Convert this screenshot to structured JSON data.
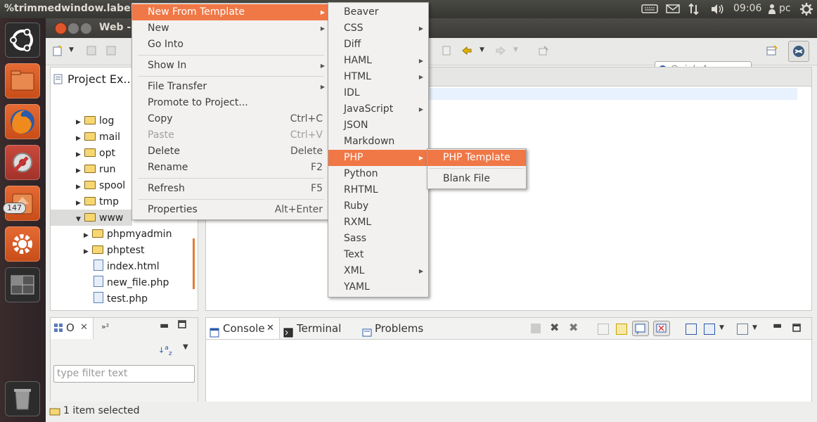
{
  "top_panel": {
    "window_title": "%trimmedwindow.label.e",
    "time": "09:06",
    "user": "pc"
  },
  "launcher": {
    "badge_count": "147",
    "items": [
      "ubuntu-dash",
      "files",
      "firefox",
      "system-settings-tools",
      "software-updater",
      "settings",
      "workspace-switcher",
      "trash"
    ]
  },
  "window": {
    "title": "Web - ",
    "quick_access_placeholder": "Quick Access"
  },
  "project_explorer": {
    "title": "Project Ex...",
    "tree": [
      {
        "label": "log",
        "type": "folder",
        "expanded": false
      },
      {
        "label": "mail",
        "type": "folder",
        "expanded": false
      },
      {
        "label": "opt",
        "type": "folder",
        "expanded": false
      },
      {
        "label": "run",
        "type": "folder",
        "expanded": false
      },
      {
        "label": "spool",
        "type": "folder",
        "expanded": false
      },
      {
        "label": "tmp",
        "type": "folder",
        "expanded": false
      },
      {
        "label": "www",
        "type": "folder",
        "expanded": true
      },
      {
        "label": "phpmyadmin",
        "type": "folder",
        "expanded": false
      },
      {
        "label": "phptest",
        "type": "folder",
        "expanded": false
      },
      {
        "label": "index.html",
        "type": "file"
      },
      {
        "label": "new_file.php",
        "type": "file"
      },
      {
        "label": "test.php",
        "type": "file"
      }
    ]
  },
  "outline_panel": {
    "tab1": "O",
    "tab2": "²",
    "filter_placeholder": "type filter text"
  },
  "bottom_panel": {
    "tabs": [
      "Console",
      "Terminal",
      "Problems"
    ]
  },
  "status_bar": {
    "text": "1 item selected"
  },
  "context_menu": {
    "items": [
      {
        "label": "New From Template",
        "shortcut": "",
        "submenu": true,
        "highlighted": true
      },
      {
        "label": "New",
        "shortcut": "",
        "submenu": true
      },
      {
        "label": "Go Into",
        "shortcut": ""
      },
      {
        "label": "Show In",
        "shortcut": "",
        "submenu": true
      },
      {
        "label": "File Transfer",
        "shortcut": "",
        "submenu": true
      },
      {
        "label": "Promote to Project...",
        "shortcut": ""
      },
      {
        "label": "Copy",
        "shortcut": "Ctrl+C"
      },
      {
        "label": "Paste",
        "shortcut": "Ctrl+V",
        "disabled": true
      },
      {
        "label": "Delete",
        "shortcut": "Delete"
      },
      {
        "label": "Rename",
        "shortcut": "F2"
      },
      {
        "label": "Refresh",
        "shortcut": "F5"
      },
      {
        "label": "Properties",
        "shortcut": "Alt+Enter"
      }
    ]
  },
  "template_menu": {
    "items": [
      {
        "label": "Beaver",
        "submenu": false
      },
      {
        "label": "CSS",
        "submenu": true
      },
      {
        "label": "Diff",
        "submenu": false
      },
      {
        "label": "HAML",
        "submenu": true
      },
      {
        "label": "HTML",
        "submenu": true
      },
      {
        "label": "IDL",
        "submenu": false
      },
      {
        "label": "JavaScript",
        "submenu": true
      },
      {
        "label": "JSON",
        "submenu": false
      },
      {
        "label": "Markdown",
        "submenu": false
      },
      {
        "label": "PHP",
        "submenu": true,
        "highlighted": true
      },
      {
        "label": "Python",
        "submenu": false
      },
      {
        "label": "RHTML",
        "submenu": false
      },
      {
        "label": "Ruby",
        "submenu": false
      },
      {
        "label": "RXML",
        "submenu": false
      },
      {
        "label": "Sass",
        "submenu": false
      },
      {
        "label": "Text",
        "submenu": false
      },
      {
        "label": "XML",
        "submenu": true
      },
      {
        "label": "YAML",
        "submenu": false
      }
    ]
  },
  "php_menu": {
    "items": [
      {
        "label": "PHP Template",
        "highlighted": true
      },
      {
        "label": "Blank File"
      }
    ]
  },
  "colors": {
    "highlight": "#f07746",
    "menu_bg": "#f2f1f0",
    "panel_dark": "#3c3b37"
  }
}
